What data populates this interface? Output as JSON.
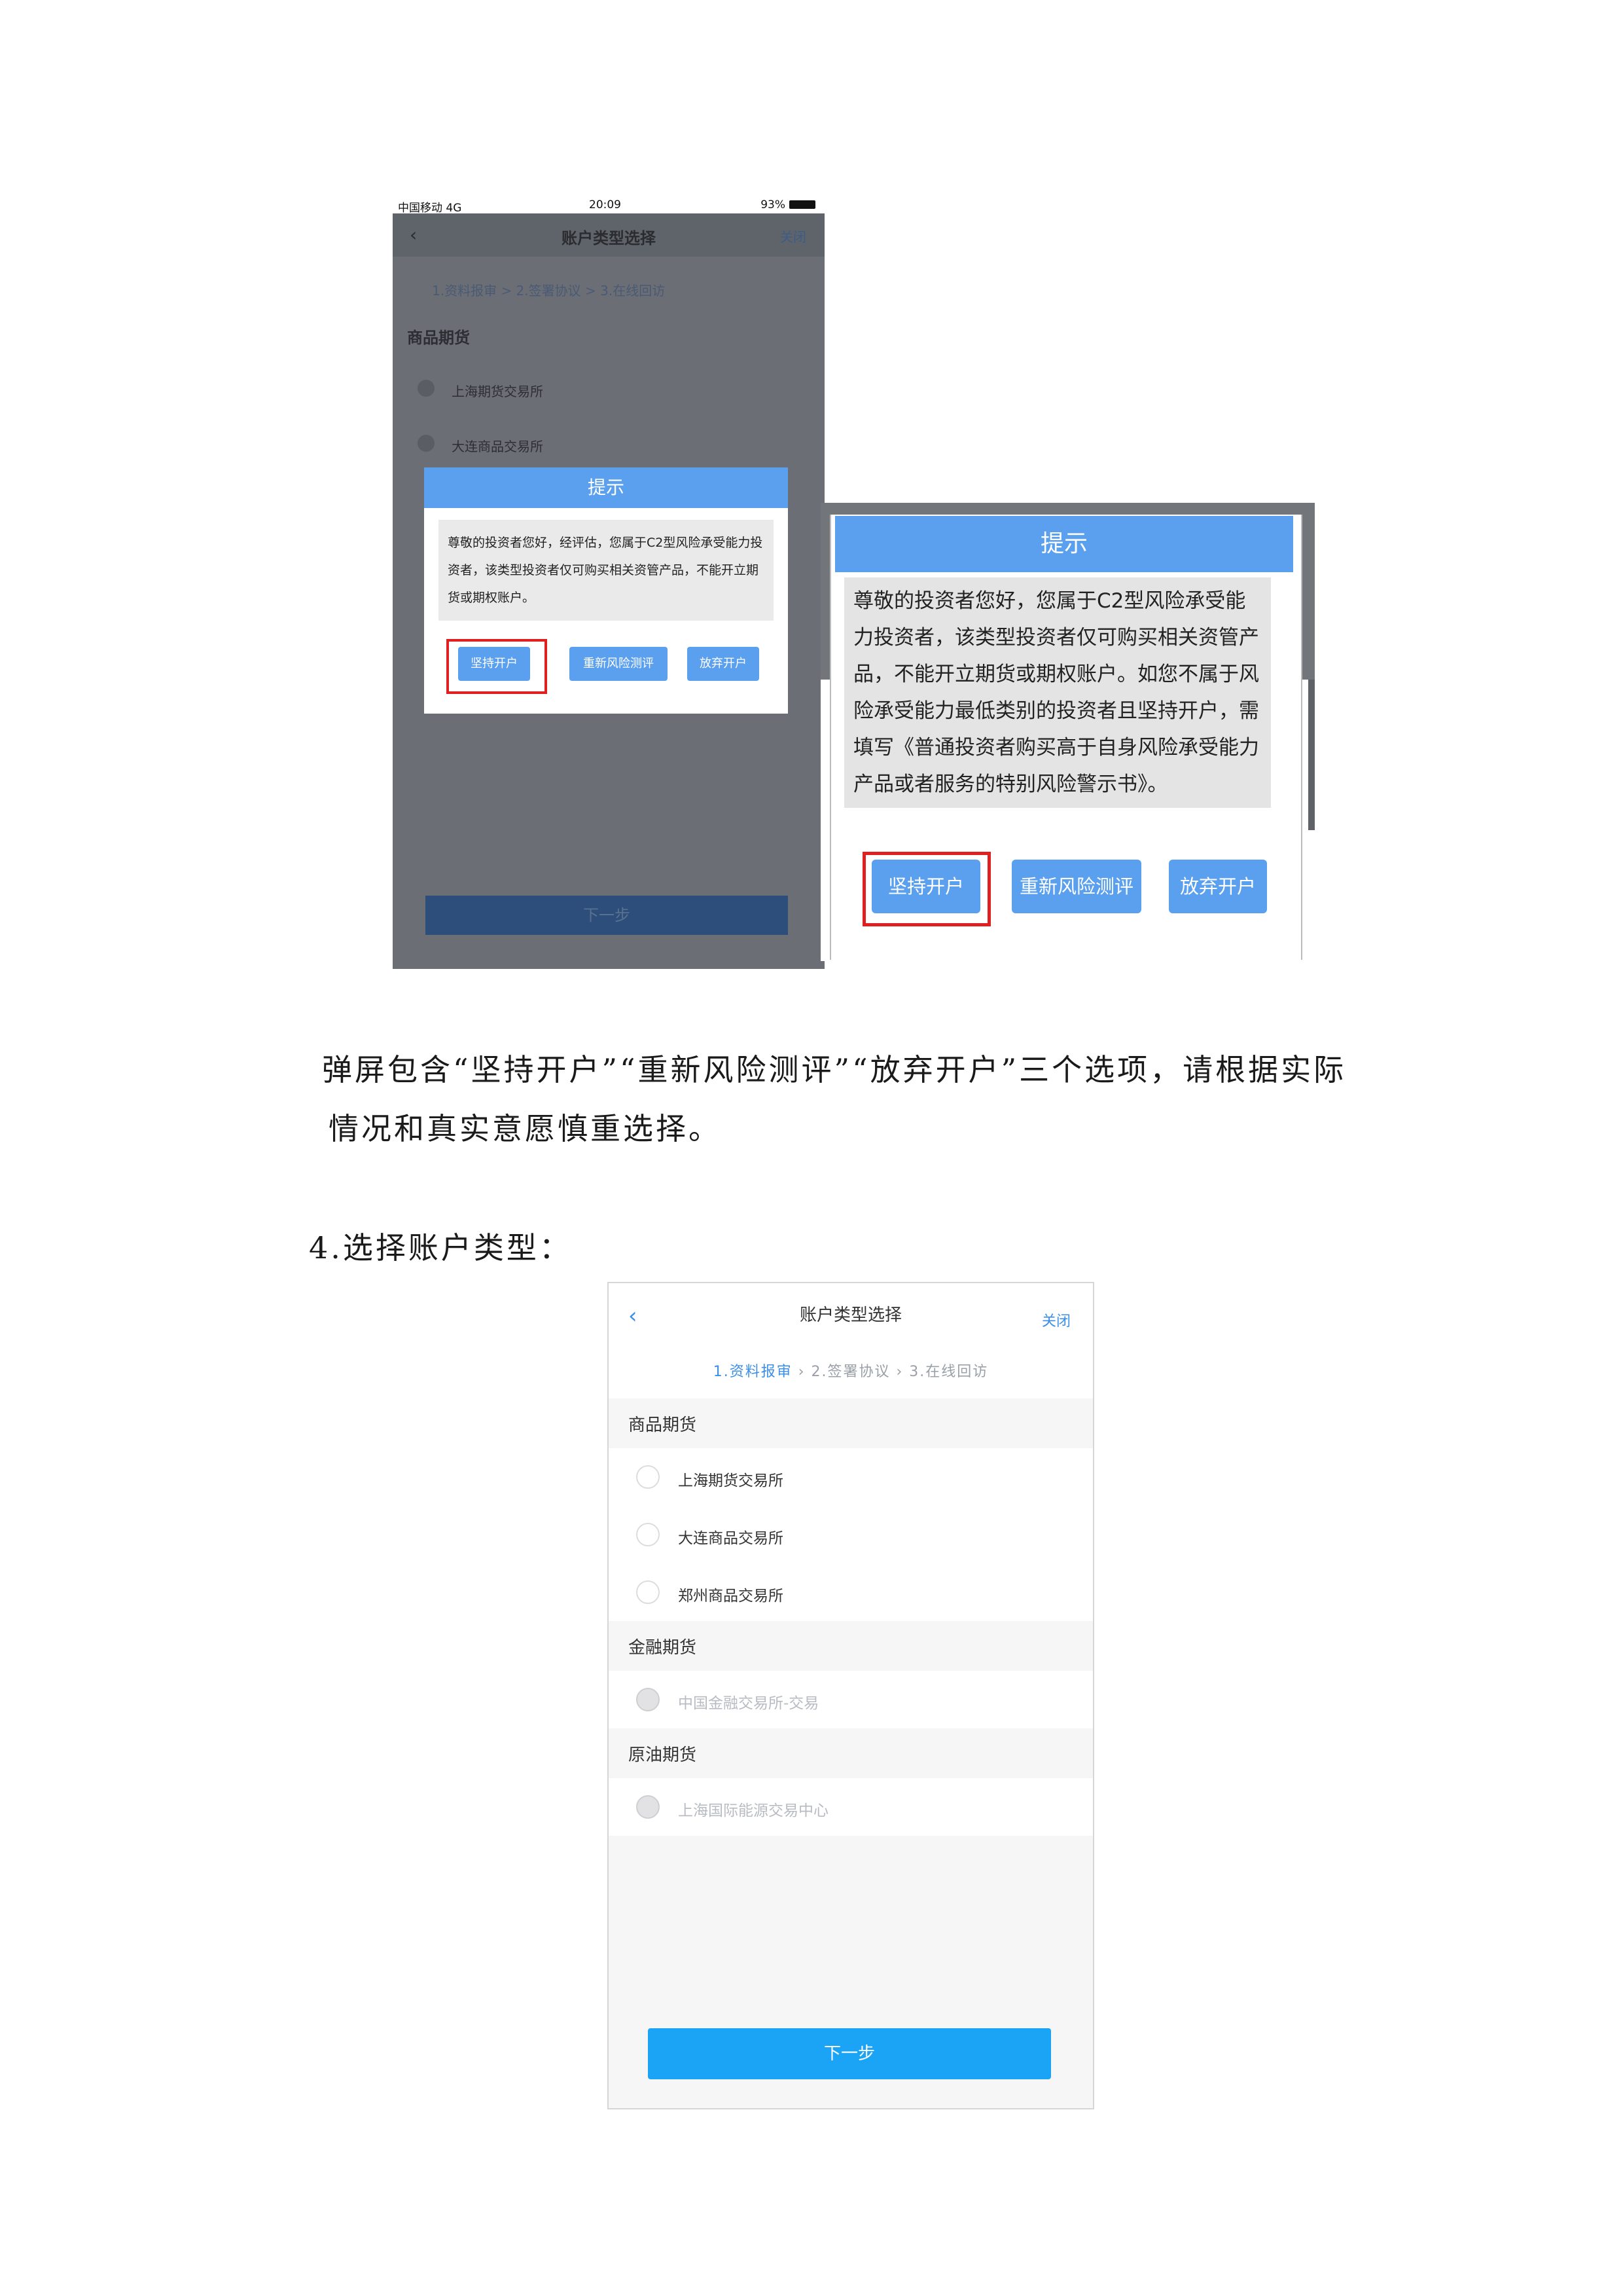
{
  "shot1": {
    "status": {
      "carrier": "中国移动 4G",
      "time": "20:09",
      "battery": "93%"
    },
    "nav": {
      "title": "账户类型选择",
      "close": "关闭"
    },
    "steps": "1.资料报审 > 2.签署协议 > 3.在线回访",
    "section": "商品期货",
    "options": [
      "上海期货交易所",
      "大连商品交易所"
    ],
    "popup": {
      "title": "提示",
      "body": "尊敬的投资者您好，经评估，您属于C2型风险承受能力投资者，该类型投资者仅可购买相关资管产品，不能开立期货或期权账户。",
      "buttons": [
        "坚持开户",
        "重新风险测评",
        "放弃开户"
      ]
    },
    "next": "下一步"
  },
  "shot2": {
    "popup": {
      "title": "提示",
      "body": "尊敬的投资者您好，您属于C2型风险承受能力投资者，该类型投资者仅可购买相关资管产品，不能开立期货或期权账户。如您不属于风险承受能力最低类别的投资者且坚持开户，需填写《普通投资者购买高于自身风险承受能力产品或者服务的特别风险警示书》。",
      "buttons": [
        "坚持开户",
        "重新风险测评",
        "放弃开户"
      ]
    }
  },
  "text": {
    "para_line1": "弹屏包含“坚持开户”“重新风险测评”“放弃开户”三个选项，请根据实际",
    "para_line2": "情况和真实意愿慎重选择。",
    "step4": "4.选择账户类型："
  },
  "shot3": {
    "nav": {
      "title": "账户类型选择",
      "close": "关闭"
    },
    "steps": {
      "s1": "1.资料报审",
      "sep1": " › ",
      "s2": "2.签署协议",
      "sep2": " › ",
      "s3": "3.在线回访"
    },
    "sections": [
      {
        "title": "商品期货",
        "options": [
          "上海期货交易所",
          "大连商品交易所",
          "郑州商品交易所"
        ]
      },
      {
        "title": "金融期货",
        "options": [
          "中国金融交易所-交易"
        ]
      },
      {
        "title": "原油期货",
        "options": [
          "上海国际能源交易中心"
        ]
      }
    ],
    "next": "下一步"
  }
}
